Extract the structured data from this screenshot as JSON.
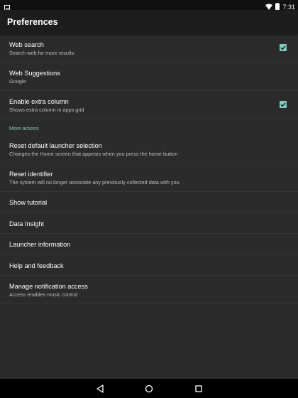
{
  "status_bar": {
    "time": "7:31",
    "icons": [
      "picture-icon",
      "wifi-icon",
      "battery-icon"
    ]
  },
  "action_bar": {
    "title": "Preferences"
  },
  "colors": {
    "accent": "#80cbc4",
    "background": "#2b2b2b"
  },
  "preferences": {
    "web_search": {
      "title": "Web search",
      "summary": "Search web for more results",
      "checked": true
    },
    "web_suggestions": {
      "title": "Web Suggestions",
      "summary": "Google"
    },
    "extra_column": {
      "title": "Enable extra column",
      "summary": "Shows extra column in apps grid",
      "checked": true
    },
    "more_actions_label": "More actions",
    "reset_launcher": {
      "title": "Reset default launcher selection",
      "summary": "Changes the Home screen that appears when you press the home button"
    },
    "reset_identifier": {
      "title": "Reset identifier",
      "summary": "The system will no longer associate any previously collected data with you"
    },
    "show_tutorial": {
      "title": "Show tutorial"
    },
    "data_insight": {
      "title": "Data Insight"
    },
    "launcher_info": {
      "title": "Launcher information"
    },
    "help_feedback": {
      "title": "Help and feedback"
    },
    "notification_access": {
      "title": "Manage notification access",
      "summary": "Access enables music control"
    }
  },
  "nav_bar": {
    "icons": [
      "back-icon",
      "home-icon",
      "recents-icon"
    ]
  }
}
